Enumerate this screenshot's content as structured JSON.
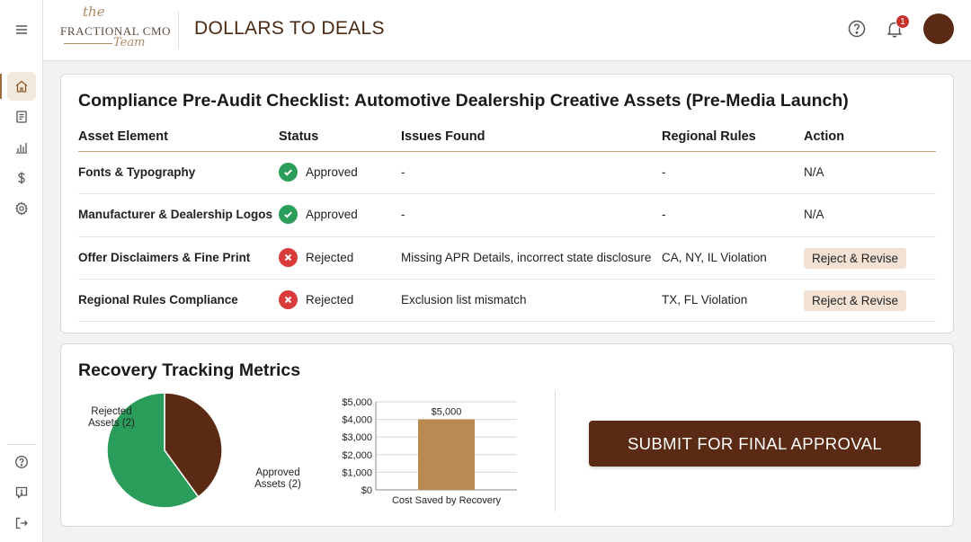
{
  "header": {
    "logo": {
      "the": "the",
      "wordmark": "FRACTIONAL CMO",
      "team": "Team"
    },
    "title": "DOLLARS TO DEALS",
    "notification_count": "1"
  },
  "sidebar": {
    "items": [
      {
        "name": "menu-icon"
      },
      {
        "name": "home-icon",
        "active": true
      },
      {
        "name": "document-icon"
      },
      {
        "name": "bar-chart-icon"
      },
      {
        "name": "dollar-icon"
      },
      {
        "name": "gear-icon"
      },
      {
        "name": "help-icon"
      },
      {
        "name": "feedback-icon"
      },
      {
        "name": "logout-icon"
      }
    ]
  },
  "checklist": {
    "title": "Compliance Pre-Audit Checklist: Automotive Dealership Creative Assets (Pre-Media Launch)",
    "columns": [
      "Asset Element",
      "Status",
      "Issues Found",
      "Regional Rules",
      "Action"
    ],
    "rows": [
      {
        "asset": "Fonts & Typography",
        "status": "Approved",
        "status_kind": "ok",
        "issues": "-",
        "rules": "-",
        "action": "N/A",
        "action_is_button": false
      },
      {
        "asset": "Manufacturer & Dealership Logos",
        "status": "Approved",
        "status_kind": "ok",
        "issues": "-",
        "rules": "-",
        "action": "N/A",
        "action_is_button": false
      },
      {
        "asset": "Offer Disclaimers & Fine Print",
        "status": "Rejected",
        "status_kind": "bad",
        "issues": "Missing APR Details, incorrect state disclosure",
        "rules": "CA, NY, IL Violation",
        "action": "Reject & Revise",
        "action_is_button": true
      },
      {
        "asset": "Regional Rules Compliance",
        "status": "Rejected",
        "status_kind": "bad",
        "issues": "Exclusion list mismatch",
        "rules": "TX, FL Violation",
        "action": "Reject & Revise",
        "action_is_button": true
      }
    ]
  },
  "metrics": {
    "title": "Recovery Tracking Metrics",
    "submit_label": "SUBMIT FOR FINAL APPROVAL"
  },
  "chart_data": [
    {
      "type": "pie",
      "slices": [
        {
          "label": "Rejected Assets (2)",
          "value": 40,
          "color": "#5a2a14"
        },
        {
          "label": "Approved Assets (2)",
          "value": 60,
          "color": "#2a9d5a"
        }
      ]
    },
    {
      "type": "bar",
      "categories": [
        "Cost Saved by Recovery"
      ],
      "values": [
        4000
      ],
      "data_labels": [
        "$5,000"
      ],
      "yticks": [
        "$0",
        "$1,000",
        "$2,000",
        "$3,000",
        "$4,000",
        "$5,000"
      ],
      "ylim": [
        0,
        5000
      ],
      "bar_color": "#b98a52",
      "grid": true
    }
  ]
}
